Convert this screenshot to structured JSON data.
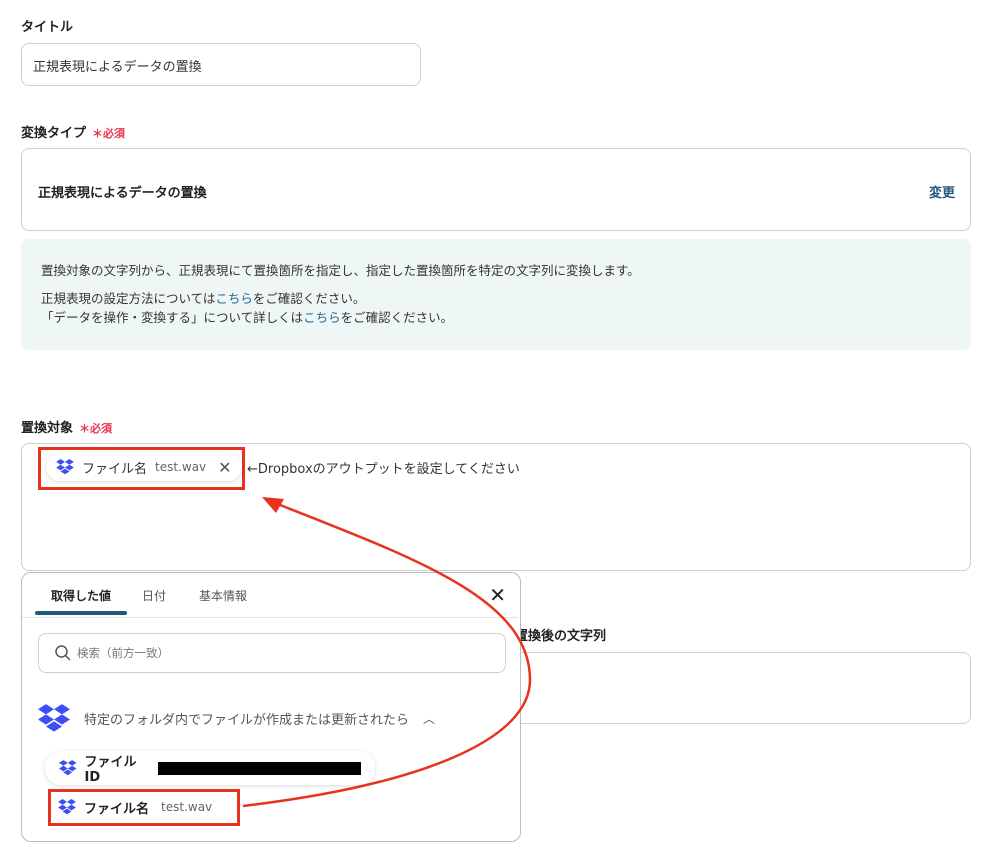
{
  "title_field": {
    "label": "タイトル",
    "value": "正規表現によるデータの置換"
  },
  "conversion_type": {
    "label": "変換タイプ",
    "required": "＊必須",
    "value": "正規表現によるデータの置換",
    "change": "変更"
  },
  "info": {
    "line1": "置換対象の文字列から、正規表現にて置換箇所を指定し、指定した置換箇所を特定の文字列に変換します。",
    "line2_pre": "正規表現の設定方法については",
    "line2_link": "こちら",
    "line2_post": "をご確認ください。",
    "line3_pre": "「データを操作・変換する」について詳しくは",
    "line3_link": "こちら",
    "line3_post": "をご確認ください。"
  },
  "target": {
    "label": "置換対象",
    "required": "＊必須",
    "chip_name": "ファイル名",
    "chip_value": "test.wav",
    "annotation": "←Dropboxのアウトプットを設定してください"
  },
  "replacement": {
    "label": "置換後の文字列"
  },
  "popup": {
    "tabs": [
      "取得した値",
      "日付",
      "基本情報"
    ],
    "search_placeholder": "検索（前方一致）",
    "group": "特定のフォルダ内でファイルが作成または更新されたら",
    "items": [
      {
        "name": "ファイルID",
        "value": ""
      },
      {
        "name": "ファイル名",
        "value": "test.wav"
      }
    ]
  },
  "colors": {
    "accent": "#1f5a78",
    "required": "#e8364f",
    "annotation": "#e8321e",
    "dropbox": "#3d4ef5"
  }
}
